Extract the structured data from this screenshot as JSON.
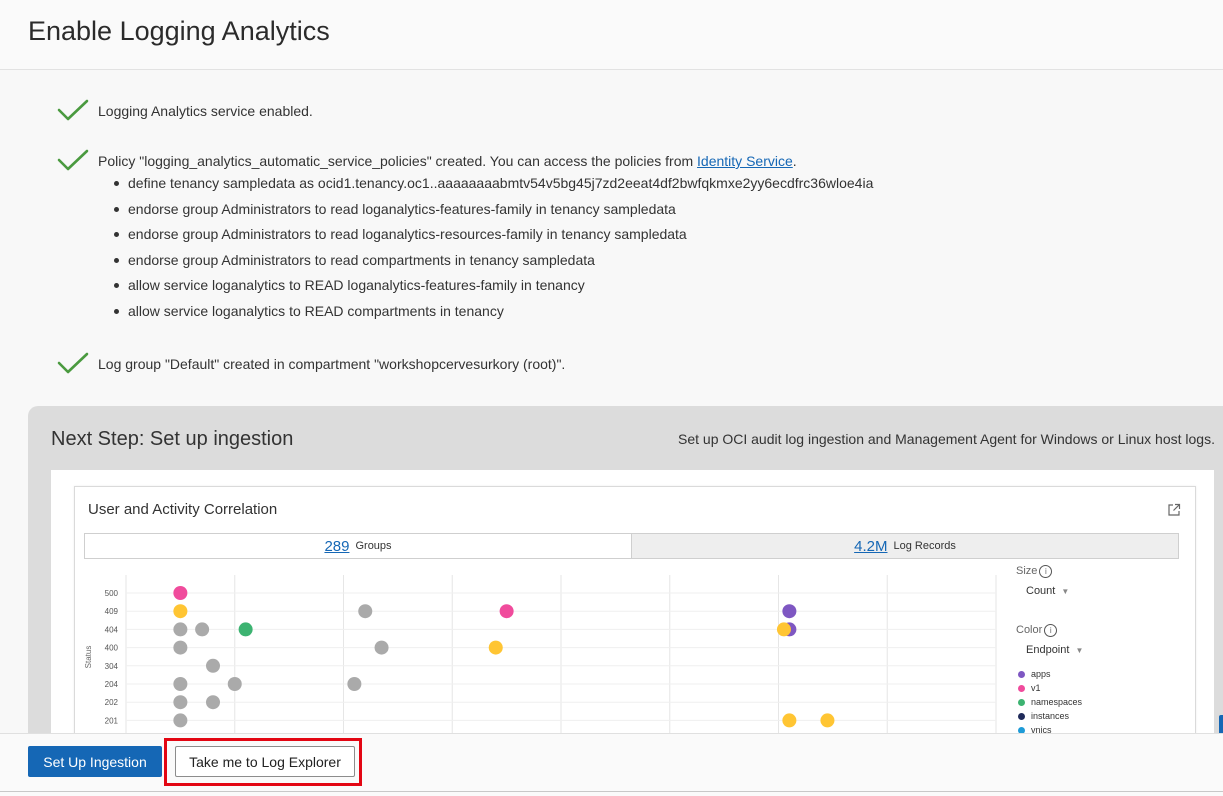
{
  "page": {
    "title": "Enable Logging Analytics"
  },
  "status": [
    {
      "text": "Logging Analytics service enabled."
    },
    {
      "text_before": "Policy \"logging_analytics_automatic_service_policies\" created. You can access the policies from ",
      "link": "Identity Service",
      "text_after": "."
    },
    {
      "text": "Log group \"Default\" created in compartment \"workshopcervesurkory (root)\"."
    }
  ],
  "policies": [
    "define tenancy sampledata as ocid1.tenancy.oc1..aaaaaaaabmtv54v5bg45j7zd2eeat4df2bwfqkmxe2yy6ecdfrc36wloe4ia",
    "endorse group Administrators to read loganalytics-features-family in tenancy sampledata",
    "endorse group Administrators to read loganalytics-resources-family in tenancy sampledata",
    "endorse group Administrators to read compartments in tenancy sampledata",
    "allow service loganalytics to READ loganalytics-features-family in tenancy",
    "allow service loganalytics to READ compartments in tenancy"
  ],
  "next_step": {
    "title": "Next Step: Set up ingestion",
    "description": "Set up OCI audit log ingestion and Management Agent for Windows or Linux host logs."
  },
  "preview": {
    "card_title": "User and Activity Correlation",
    "tabs": [
      {
        "value": "289",
        "label": "Groups"
      },
      {
        "value": "4.2M",
        "label": "Log Records"
      }
    ],
    "ylabel": "Status",
    "size_label": "Size",
    "size_value": "Count",
    "color_label": "Color",
    "color_value": "Endpoint",
    "legend": [
      {
        "name": "apps",
        "color": "#7e57c2"
      },
      {
        "name": "v1",
        "color": "#f04b9c"
      },
      {
        "name": "namespaces",
        "color": "#3cb371"
      },
      {
        "name": "instances",
        "color": "#1f2a5a"
      },
      {
        "name": "vnics",
        "color": "#1e9bd7"
      }
    ]
  },
  "chart_data": {
    "type": "scatter",
    "ylabel": "Status",
    "y_categories": [
      "500",
      "409",
      "404",
      "400",
      "304",
      "204",
      "202",
      "201"
    ],
    "colors": {
      "apps": "#7e57c2",
      "v1": "#f04b9c",
      "namespaces": "#3cb371",
      "other": "#aaaaaa",
      "highlight": "#ffc533"
    },
    "points": [
      {
        "x": 1,
        "y": "500",
        "group": "v1"
      },
      {
        "x": 1,
        "y": "409",
        "group": "highlight"
      },
      {
        "x": 1,
        "y": "404",
        "group": "other"
      },
      {
        "x": 1.2,
        "y": "404",
        "group": "other"
      },
      {
        "x": 1.6,
        "y": "404",
        "group": "namespaces"
      },
      {
        "x": 1,
        "y": "400",
        "group": "other"
      },
      {
        "x": 1.3,
        "y": "304",
        "group": "other"
      },
      {
        "x": 1,
        "y": "204",
        "group": "other"
      },
      {
        "x": 1.5,
        "y": "204",
        "group": "other"
      },
      {
        "x": 1,
        "y": "202",
        "group": "other"
      },
      {
        "x": 1.3,
        "y": "202",
        "group": "other"
      },
      {
        "x": 1,
        "y": "201",
        "group": "other"
      },
      {
        "x": 2.7,
        "y": "409",
        "group": "other"
      },
      {
        "x": 2.85,
        "y": "400",
        "group": "other"
      },
      {
        "x": 2.6,
        "y": "204",
        "group": "other"
      },
      {
        "x": 4.0,
        "y": "409",
        "group": "v1"
      },
      {
        "x": 3.9,
        "y": "400",
        "group": "highlight"
      },
      {
        "x": 6.6,
        "y": "409",
        "group": "apps"
      },
      {
        "x": 6.6,
        "y": "404",
        "group": "apps"
      },
      {
        "x": 6.55,
        "y": "404",
        "group": "highlight"
      },
      {
        "x": 6.6,
        "y": "201",
        "group": "highlight"
      },
      {
        "x": 6.95,
        "y": "201",
        "group": "highlight"
      }
    ]
  },
  "footer": {
    "primary_label": "Set Up Ingestion",
    "secondary_label": "Take me to Log Explorer"
  }
}
